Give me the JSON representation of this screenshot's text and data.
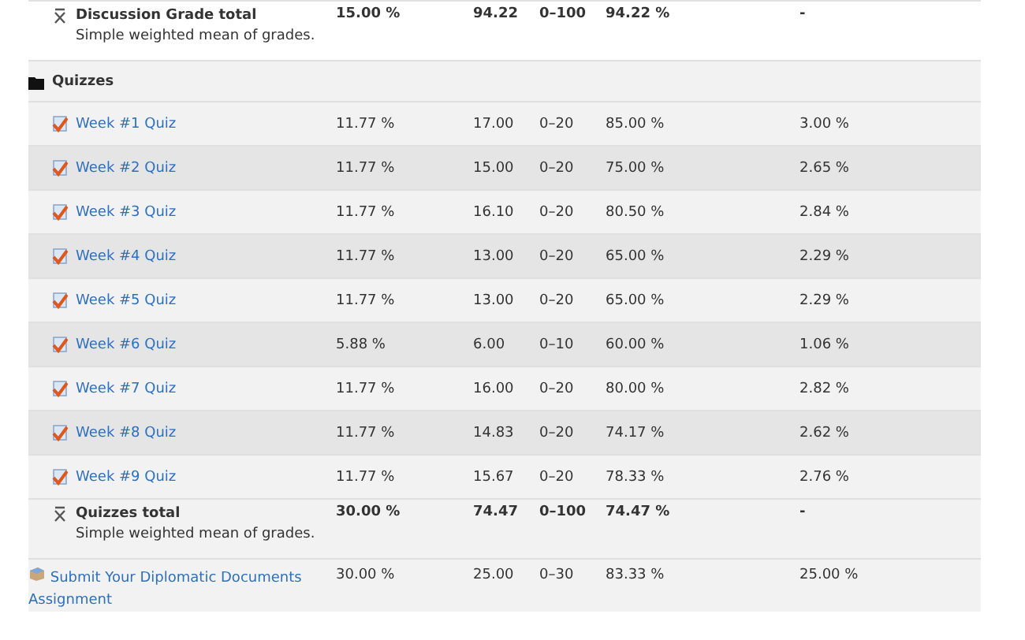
{
  "rows": [
    {
      "kind": "total",
      "name": "Discussion Grade total",
      "subtitle": "Simple weighted mean of grades.",
      "weight": "15.00 %",
      "grade": "94.22",
      "range": "0–100",
      "percentage": "94.22 %",
      "contribution": "-"
    },
    {
      "kind": "category",
      "name": "Quizzes"
    },
    {
      "kind": "item",
      "name": "Week #1 Quiz",
      "weight": "11.77 %",
      "grade": "17.00",
      "range": "0–20",
      "percentage": "85.00 %",
      "contribution": "3.00 %"
    },
    {
      "kind": "item",
      "name": "Week #2 Quiz",
      "weight": "11.77 %",
      "grade": "15.00",
      "range": "0–20",
      "percentage": "75.00 %",
      "contribution": "2.65 %"
    },
    {
      "kind": "item",
      "name": "Week #3 Quiz",
      "weight": "11.77 %",
      "grade": "16.10",
      "range": "0–20",
      "percentage": "80.50 %",
      "contribution": "2.84 %"
    },
    {
      "kind": "item",
      "name": "Week #4 Quiz",
      "weight": "11.77 %",
      "grade": "13.00",
      "range": "0–20",
      "percentage": "65.00 %",
      "contribution": "2.29 %"
    },
    {
      "kind": "item",
      "name": "Week #5 Quiz",
      "weight": "11.77 %",
      "grade": "13.00",
      "range": "0–20",
      "percentage": "65.00 %",
      "contribution": "2.29 %"
    },
    {
      "kind": "item",
      "name": "Week #6 Quiz",
      "weight": "5.88 %",
      "grade": "6.00",
      "range": "0–10",
      "percentage": "60.00 %",
      "contribution": "1.06 %"
    },
    {
      "kind": "item",
      "name": "Week #7 Quiz",
      "weight": "11.77 %",
      "grade": "16.00",
      "range": "0–20",
      "percentage": "80.00 %",
      "contribution": "2.82 %"
    },
    {
      "kind": "item",
      "name": "Week #8 Quiz",
      "weight": "11.77 %",
      "grade": "14.83",
      "range": "0–20",
      "percentage": "74.17 %",
      "contribution": "2.62 %"
    },
    {
      "kind": "item",
      "name": "Week #9 Quiz",
      "weight": "11.77 %",
      "grade": "15.67",
      "range": "0–20",
      "percentage": "78.33 %",
      "contribution": "2.76 %"
    },
    {
      "kind": "total",
      "name": "Quizzes total",
      "subtitle": "Simple weighted mean of grades.",
      "weight": "30.00 %",
      "grade": "74.47",
      "range": "0–100",
      "percentage": "74.47 %",
      "contribution": "-"
    },
    {
      "kind": "assignment",
      "name": "Submit Your Diplomatic Documents Assignment",
      "weight": "30.00 %",
      "grade": "25.00",
      "range": "0–30",
      "percentage": "83.33 %",
      "contribution": "25.00 %"
    }
  ]
}
